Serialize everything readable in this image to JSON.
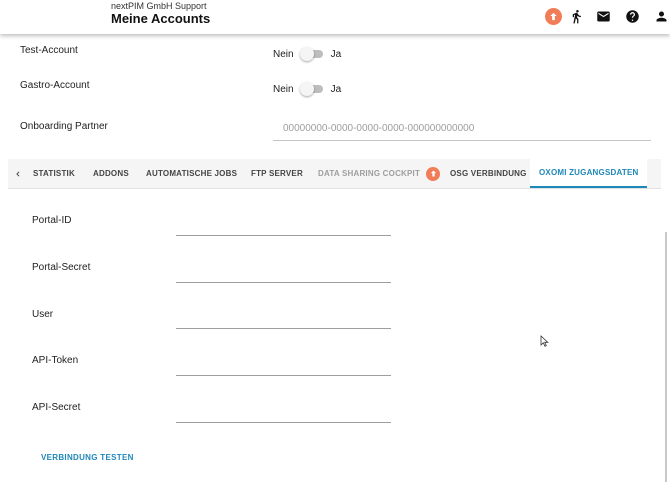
{
  "header": {
    "company": "nextPIM GmbH Support",
    "title": "Meine Accounts",
    "icons": [
      "upload-icon",
      "run-icon",
      "mail-icon",
      "help-icon",
      "person-icon"
    ],
    "accent_color": "#f07d58"
  },
  "settings": {
    "test_account": {
      "label": "Test-Account",
      "off_label": "Nein",
      "on_label": "Ja",
      "value": false
    },
    "gastro_account": {
      "label": "Gastro-Account",
      "off_label": "Nein",
      "on_label": "Ja",
      "value": false
    },
    "onboarding_partner": {
      "label": "Onboarding Partner",
      "placeholder": "00000000-0000-0000-0000-000000000000",
      "value": ""
    }
  },
  "tabs": {
    "items": [
      {
        "label": "STATISTIK"
      },
      {
        "label": "ADDONS"
      },
      {
        "label": "AUTOMATISCHE JOBS"
      },
      {
        "label": "FTP SERVER"
      },
      {
        "label": "DATA SHARING COCKPIT"
      },
      {
        "label": "OSG VERBINDUNG"
      },
      {
        "label": "OXOMI ZUGANGSDATEN"
      }
    ],
    "active": "OXOMI ZUGANGSDATEN",
    "active_color": "#1e88b8"
  },
  "oxomi": {
    "fields": [
      {
        "label": "Portal-ID",
        "value": ""
      },
      {
        "label": "Portal-Secret",
        "value": ""
      },
      {
        "label": "User",
        "value": ""
      },
      {
        "label": "API-Token",
        "value": ""
      },
      {
        "label": "API-Secret",
        "value": ""
      }
    ],
    "test_button": "VERBINDUNG TESTEN"
  }
}
